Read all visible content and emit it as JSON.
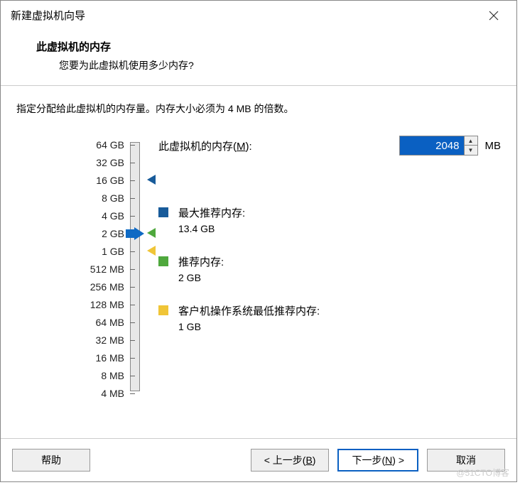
{
  "title": "新建虚拟机向导",
  "header": {
    "heading": "此虚拟机的内存",
    "subheading": "您要为此虚拟机使用多少内存?"
  },
  "instruction": "指定分配给此虚拟机的内存量。内存大小必须为 4 MB 的倍数。",
  "memory": {
    "label_prefix": "此虚拟机的内存(",
    "label_hotkey": "M",
    "label_suffix": "):",
    "value": "2048",
    "unit": "MB"
  },
  "scale_labels": [
    "64 GB",
    "32 GB",
    "16 GB",
    "8 GB",
    "4 GB",
    "2 GB",
    "1 GB",
    "512 MB",
    "256 MB",
    "128 MB",
    "64 MB",
    "32 MB",
    "16 MB",
    "8 MB",
    "4 MB"
  ],
  "info": {
    "max": {
      "title": "最大推荐内存:",
      "value": "13.4 GB"
    },
    "rec": {
      "title": "推荐内存:",
      "value": "2 GB"
    },
    "min": {
      "title": "客户机操作系统最低推荐内存:",
      "value": "1 GB"
    }
  },
  "buttons": {
    "help": "帮助",
    "back_prefix": "< 上一步(",
    "back_hotkey": "B",
    "back_suffix": ")",
    "next_prefix": "下一步(",
    "next_hotkey": "N",
    "next_suffix": ") >",
    "cancel": "取消"
  },
  "watermark": "@51CTO博客"
}
